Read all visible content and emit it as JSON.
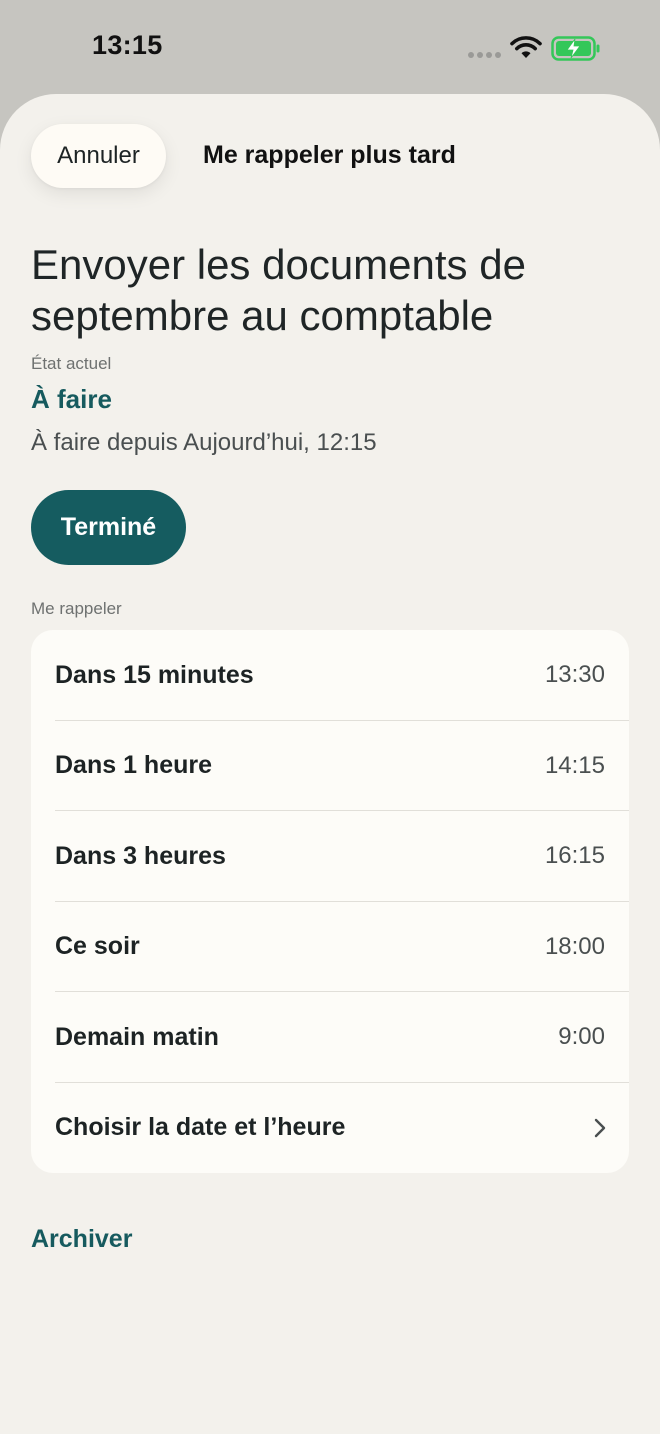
{
  "status_bar": {
    "time": "13:15"
  },
  "header": {
    "cancel_label": "Annuler",
    "title": "Me rappeler plus tard"
  },
  "task": {
    "title": "Envoyer les documents de septembre au comptable",
    "state_label": "État actuel",
    "state_value": "À faire",
    "state_since": "À faire depuis Aujourd’hui, 12:15"
  },
  "done_button_label": "Terminé",
  "remind": {
    "section_label": "Me rappeler",
    "options": [
      {
        "label": "Dans 15 minutes",
        "time": "13:30"
      },
      {
        "label": "Dans 1 heure",
        "time": "14:15"
      },
      {
        "label": "Dans 3 heures",
        "time": "16:15"
      },
      {
        "label": "Ce soir",
        "time": "18:00"
      },
      {
        "label": "Demain matin",
        "time": "9:00"
      }
    ],
    "custom_label": "Choisir la date et l’heure"
  },
  "archive_label": "Archiver",
  "colors": {
    "accent": "#155c60",
    "sheet_background": "#f3f1ec",
    "card_background": "#fdfcf8",
    "battery_charging": "#34c759"
  }
}
